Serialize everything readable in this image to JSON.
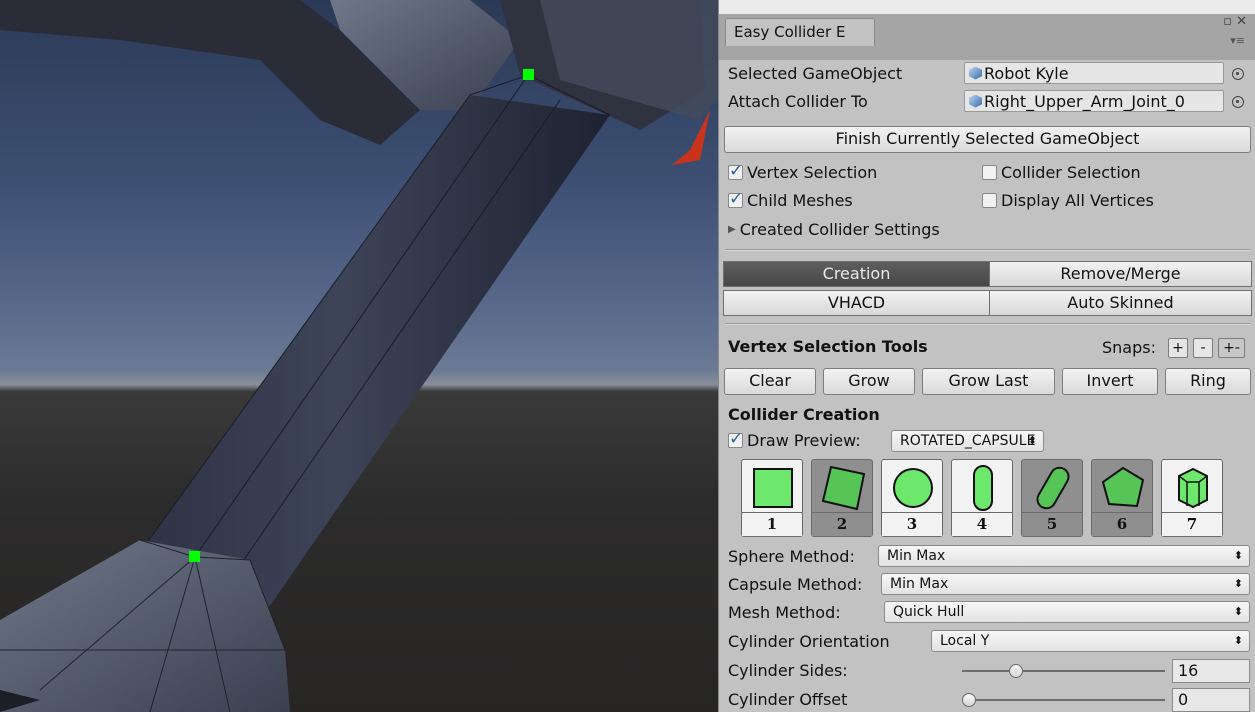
{
  "window": {
    "tab_title": "Easy Collider E",
    "btn_maximize": "▫",
    "btn_close": "✕",
    "menu_icon": "▾≡"
  },
  "fields": {
    "selected_label": "Selected GameObject",
    "selected_value": "Robot Kyle",
    "attach_label": "Attach Collider To",
    "attach_value": "Right_Upper_Arm_Joint_0"
  },
  "finish_button": "Finish Currently Selected GameObject",
  "toggles": {
    "vertex_selection": {
      "label": "Vertex Selection",
      "checked": true
    },
    "collider_selection": {
      "label": "Collider Selection",
      "checked": false
    },
    "child_meshes": {
      "label": "Child Meshes",
      "checked": true
    },
    "display_all_vertices": {
      "label": "Display All Vertices",
      "checked": false
    }
  },
  "foldout": {
    "arrow": "▶",
    "label": "Created Collider Settings"
  },
  "mode_tabs": [
    "Creation",
    "Remove/Merge",
    "VHACD",
    "Auto Skinned"
  ],
  "active_tab": "Creation",
  "vertex_tools": {
    "header": "Vertex Selection Tools",
    "snaps_label": "Snaps:",
    "snap_buttons": [
      "+",
      "-",
      "+-"
    ],
    "buttons": [
      "Clear",
      "Grow",
      "Grow Last",
      "Invert",
      "Ring"
    ]
  },
  "collider_creation": {
    "header": "Collider Creation",
    "draw_preview_label": "Draw Preview:",
    "draw_preview_checked": true,
    "preview_type": "ROTATED_CAPSULE",
    "dropdown_arrow": "⬍",
    "shapes": [
      {
        "icon": "box-icon",
        "number": "1"
      },
      {
        "icon": "rotated-box-icon",
        "number": "2"
      },
      {
        "icon": "sphere-icon",
        "number": "3"
      },
      {
        "icon": "capsule-icon",
        "number": "4"
      },
      {
        "icon": "rotated-capsule-icon",
        "number": "5"
      },
      {
        "icon": "convex-mesh-icon",
        "number": "6"
      },
      {
        "icon": "cylinder-icon",
        "number": "7"
      }
    ]
  },
  "settings": {
    "sphere_method_label": "Sphere Method:",
    "sphere_method_value": "Min Max",
    "capsule_method_label": "Capsule Method:",
    "capsule_method_value": "Min Max",
    "mesh_method_label": "Mesh Method:",
    "mesh_method_value": "Quick Hull",
    "cylinder_orientation_label": "Cylinder Orientation",
    "cylinder_orientation_value": "Local Y",
    "cylinder_sides_label": "Cylinder Sides:",
    "cylinder_sides_value": "16",
    "cylinder_sides_fraction": 0.25,
    "cylinder_offset_label": "Cylinder Offset",
    "cylinder_offset_value": "0",
    "cylinder_offset_fraction": 0.0
  },
  "colors": {
    "vertex_marker": "#00ff00",
    "active_tab": "#4f4f4f",
    "shape_fill": "#6de86d"
  }
}
